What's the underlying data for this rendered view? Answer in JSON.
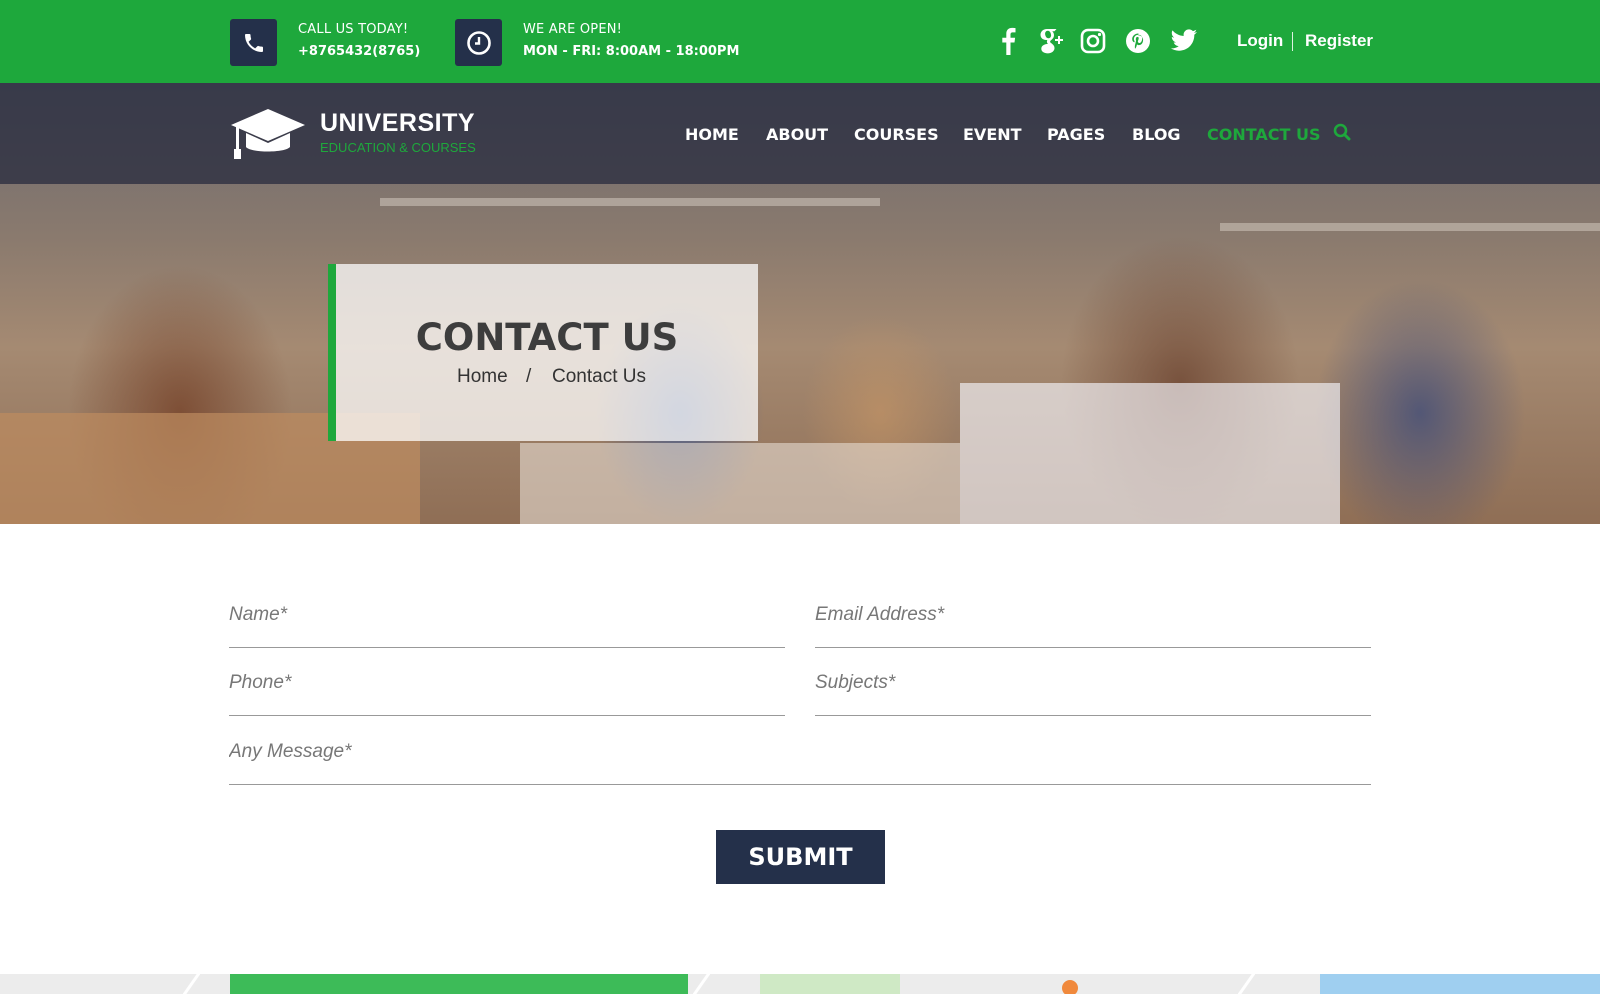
{
  "topbar": {
    "call_label": "CALL US TODAY!",
    "call_number": "+8765432(8765)",
    "open_label": "WE ARE OPEN!",
    "open_hours": "MON - FRI: 8:00AM - 18:00PM",
    "social_icons": [
      "facebook-icon",
      "google-plus-icon",
      "instagram-icon",
      "pinterest-icon",
      "twitter-icon"
    ],
    "login": "Login",
    "register": "Register"
  },
  "brand": {
    "name": "UNIVERSITY",
    "tagline": "EDUCATION & COURSES"
  },
  "nav": {
    "items": [
      {
        "label": "HOME"
      },
      {
        "label": "ABOUT"
      },
      {
        "label": "COURSES"
      },
      {
        "label": "EVENT"
      },
      {
        "label": "PAGES"
      },
      {
        "label": "BLOG"
      },
      {
        "label": "CONTACT US"
      }
    ],
    "active": "CONTACT US"
  },
  "hero": {
    "title": "CONTACT US",
    "breadcrumb_home": "Home",
    "breadcrumb_sep": "/",
    "breadcrumb_current": "Contact Us"
  },
  "form": {
    "name_placeholder": "Name*",
    "email_placeholder": "Email Address*",
    "phone_placeholder": "Phone*",
    "subject_placeholder": "Subjects*",
    "message_placeholder": "Any Message*",
    "submit": "SUBMIT"
  },
  "colors": {
    "accent": "#1ea83c",
    "dark": "#24304a"
  }
}
